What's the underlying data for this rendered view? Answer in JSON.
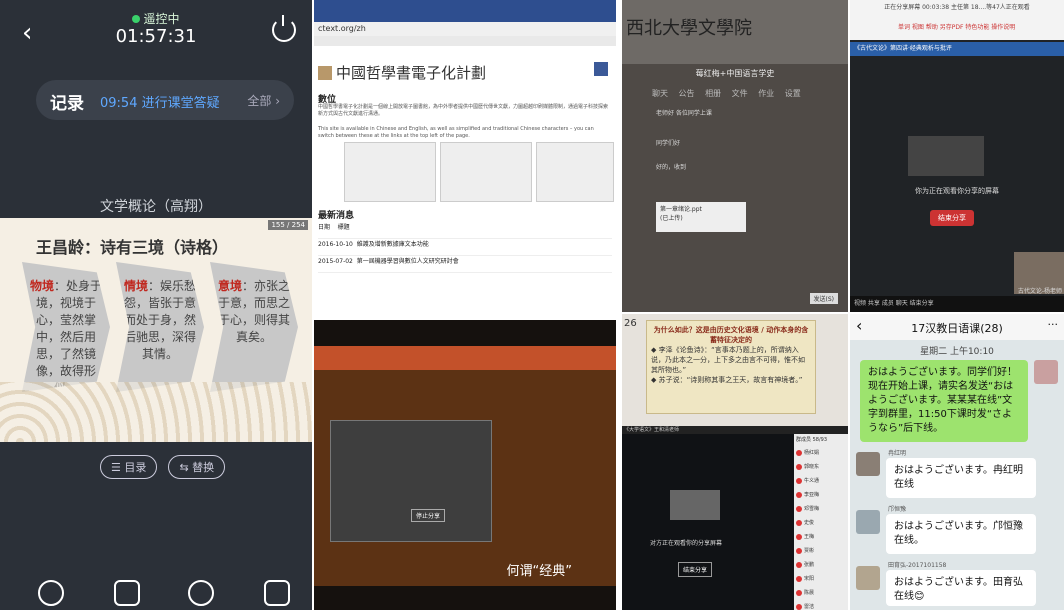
{
  "phone_control": {
    "status": "遥控中",
    "timer": "01:57:31",
    "record_label": "记录",
    "record_event": "09:54 进行课堂答疑",
    "record_all": "全部 ›",
    "course_title": "文学概论（高翔）",
    "page_indicator": "155 / 254",
    "slide": {
      "title": "王昌龄：诗有三境（诗格）",
      "blocks": [
        {
          "key": "物境",
          "text": "：处身于境，视境于心，莹然掌中，然后用思，了然镜像，故得形似。"
        },
        {
          "key": "情境",
          "text": "：娱乐愁怨，皆张于意而处于身，然后驰思，深得其情。"
        },
        {
          "key": "意境",
          "text": "：亦张之于意，而思之于心，则得其真矣。"
        }
      ]
    },
    "chips": [
      "☰ 目录",
      "⇆ 替换"
    ]
  },
  "browser": {
    "address": "ctext.org/zh",
    "site_title": "中國哲學書電子化計劃",
    "section_intro": "數位",
    "intro_text": "中國哲學書電子化計劃是一個線上開放電子圖書館，為中外學者提供中國歷代傳世文獻，力圖超越印刷媒體限制，通過電子科技探索新方式與古代文獻進行溝通。",
    "english_note": "This site is available in Chinese and English, as well as simplified and traditional Chinese characters – you can switch between these at the links at the top left of the page.",
    "section_news": "最新消息",
    "news_header": [
      "日期",
      "標題"
    ],
    "news": [
      {
        "date": "2016-10-10",
        "text": "維護及增新數據庫文本功能"
      },
      {
        "date": "2015-07-02",
        "text": "第一屆機器學習與數位人文研究研討會"
      }
    ]
  },
  "projector": {
    "share_button": "停止分享",
    "caption": "何谓“经典”"
  },
  "chat_client": {
    "logo_text": "西北大學文學院",
    "group_name": "莓红梅+中国语言学史",
    "tabs": [
      "聊天",
      "公告",
      "相册",
      "文件",
      "作业",
      "设置"
    ],
    "messages": [
      "老师好 各位同学上课",
      "同学们好",
      "好的，收到"
    ],
    "file_name": "第一章绪论.ppt",
    "file_status": "(已上传)",
    "send_label": "发送(S)"
  },
  "share_app": {
    "top_title": "正在分享屏幕  00:03:38   主任第 18....等47人正在观看",
    "share_label": "单词  视图  帮助  另存PDF  特色功能  操作说明",
    "breadcrumb": "《古代文论》第四讲·经典观析与批评",
    "sharing_text": "你为正在观看你分享的屏幕",
    "stop_button": "结束分享",
    "camera_label": "古代文论-杨老师",
    "toolbar_text": "视频  共享  成员  聊天  结束分享"
  },
  "desktop": {
    "page_no": "26",
    "slide_question": "为什么如此？这是由历史文化语境 / 动作本身的含蓄特征决定的",
    "slide_points": [
      "◆ 李泽《论鱼诗》：“言事本乃题上的，所谓纳入说，乃此本之一分，上下多之由言不可得，惟不如其所物也。”",
      "◆ 苏子说：“诗则称其事之王天，故言有神境者。”"
    ],
    "window_title": "《大学语文》王和清老师",
    "share_text": "对方正在观看你的分享屏幕",
    "share_stop": "结束分享",
    "list_header": "群成员 58/93",
    "list_items": [
      "杨红娟",
      "郭晓东",
      "牛义通",
      "李亚梅",
      "邓雪梅",
      "史俊",
      "王梅",
      "贾彬",
      "张鹏",
      "宋阳",
      "陈晨",
      "雷洁"
    ]
  },
  "wechat": {
    "title": "17汉教日语课(28)",
    "more": "···",
    "time": "星期二 上午10:10",
    "teacher_msg": "おはようございます。同学们好！现在开始上课，请实名发送“おはようございます。某某某在线”文字到群里，11:50下课时发“さようなら”后下线。",
    "replies": [
      {
        "name": "冉红明",
        "text": "おはようございます。冉红明在线"
      },
      {
        "name": "邝恒豫",
        "text": "おはようございます。邝恒豫在线。"
      },
      {
        "name": "田育弘-2017101158",
        "text": "おはようございます。田育弘在线😊"
      }
    ]
  }
}
